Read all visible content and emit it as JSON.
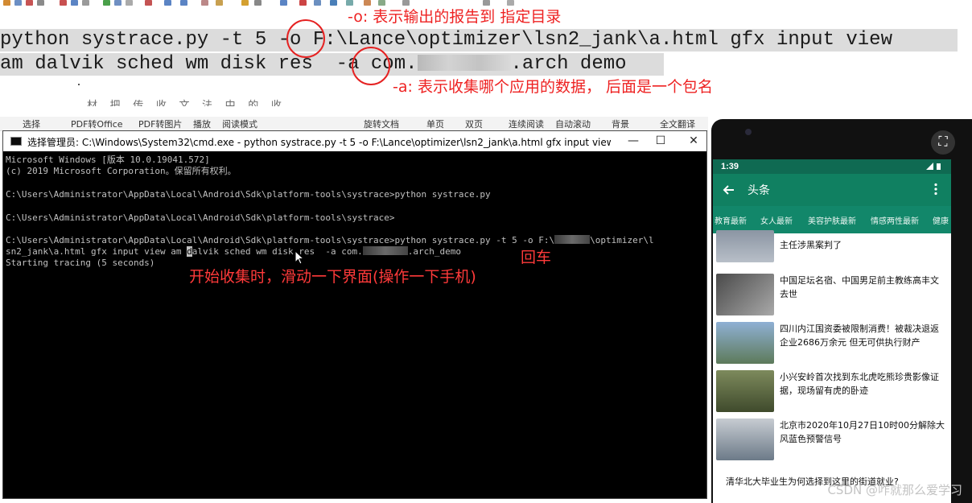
{
  "command": {
    "line1_before_o": "python systrace.py -t 5 ",
    "flag_o": "-o",
    "line1_after_o": " F:\\Lance\\optimizer\\lsn2_jank\\a.html gfx input view",
    "line2_before_a": "am dalvik sched wm disk res  ",
    "flag_a": "-a",
    "line2_package_start": " com.",
    "line2_package_end": ".arch demo"
  },
  "annotations": {
    "o_note": "-o: 表示输出的报告到 指定目录",
    "a_note": "-a: 表示收集哪个应用的数据， 后面是一个包名",
    "enter_note": "回车",
    "collect_note": "开始收集时，滑动一下界面(操作一下手机)",
    "faded_text": "材 把 传 收 文 法 中 的 收"
  },
  "pdf_toolbar": {
    "items": [
      "选择",
      "PDF转Office",
      "PDF转图片",
      "播放",
      "阅读模式",
      "旋转文档",
      "单页",
      "双页",
      "连续阅读",
      "自动滚动",
      "背景",
      "全文翻译"
    ]
  },
  "cmd_window": {
    "title": "选择管理员: C:\\Windows\\System32\\cmd.exe - python  systrace.py -t 5 -o F:\\Lance\\optimizer\\lsn2_jank\\a.html gfx input view am dalvik sche...",
    "minimize": "—",
    "maximize": "☐",
    "close": "✕",
    "lines": [
      "Microsoft Windows [版本 10.0.19041.572]",
      "(c) 2019 Microsoft Corporation。保留所有权利。",
      "",
      "C:\\Users\\Administrator\\AppData\\Local\\Android\\Sdk\\platform-tools\\systrace>python systrace.py",
      "",
      "C:\\Users\\Administrator\\AppData\\Local\\Android\\Sdk\\platform-tools\\systrace>",
      ""
    ],
    "cmd_line_a": "C:\\Users\\Administrator\\AppData\\Local\\Android\\Sdk\\platform-tools\\systrace>python systrace.py -t 5 -o F:\\",
    "cmd_line_a_end": "\\optimizer\\l",
    "cmd_line_b_start": "sn2_jank\\a.html gfx input view am ",
    "cmd_line_b_cursor": "d",
    "cmd_line_b_mid": "alvik sched wm disk res  -a com.",
    "cmd_line_b_end": ".arch_demo",
    "tracing_line": "Starting tracing (5 seconds)"
  },
  "phone": {
    "time": "1:39",
    "title": "头条",
    "back_icon": "arrow-left-icon",
    "menu_icon": "more-vert-icon",
    "tabs": [
      "教育最新",
      "女人最新",
      "美容护肤最新",
      "情感两性最新",
      "健康"
    ],
    "news": [
      {
        "title": "主任涉黑案判了",
        "thumb_color": "#8b95a3"
      },
      {
        "title": "中国足坛名宿、中国男足前主教练高丰文去世",
        "thumb_color": "#6d6d6d"
      },
      {
        "title": "四川内江国资委被限制消费！被裁决退返企业2686万余元 但无可供执行财产",
        "thumb_color": "#6f8fb5"
      },
      {
        "title": "小兴安岭首次找到东北虎吃熊珍贵影像证据，现场留有虎的卧迹",
        "thumb_color": "#5d6a45"
      },
      {
        "title": "北京市2020年10月27日10时00分解除大风蓝色预警信号",
        "thumb_color": "#9aa4ad"
      }
    ],
    "bottom_question": "清华北大毕业生为何选择到这里的街道就业?"
  },
  "watermark": "CSDN @咋就那么爱学习"
}
